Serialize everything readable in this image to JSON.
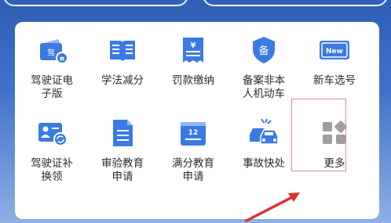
{
  "services": {
    "row1": [
      {
        "label": "驾驶证电子版",
        "icon": "license-card-icon"
      },
      {
        "label": "学法减分",
        "icon": "book-icon"
      },
      {
        "label": "罚款缴纳",
        "icon": "receipt-icon"
      },
      {
        "label": "备案非本人机动车",
        "icon": "shield-badge-icon"
      },
      {
        "label": "新车选号",
        "icon": "license-plate-icon"
      }
    ],
    "row2": [
      {
        "label": "驾驶证补换领",
        "icon": "id-card-refresh-icon"
      },
      {
        "label": "审验教育申请",
        "icon": "document-icon"
      },
      {
        "label": "满分教育申请",
        "icon": "calendar-icon"
      },
      {
        "label": "事故快处",
        "icon": "car-accident-icon"
      },
      {
        "label": "更多",
        "icon": "grid-more-icon"
      }
    ],
    "icon_badges": {
      "license": "驾",
      "shield": "备",
      "plate": "New",
      "receipt": "¥",
      "calendar": "12"
    }
  },
  "colors": {
    "accent": "#3b7ae3",
    "icon_light": "#8fb7f3",
    "more_icon": "#9e9e9e",
    "highlight_box": "#e08a8a",
    "arrow": "#e0302a"
  }
}
